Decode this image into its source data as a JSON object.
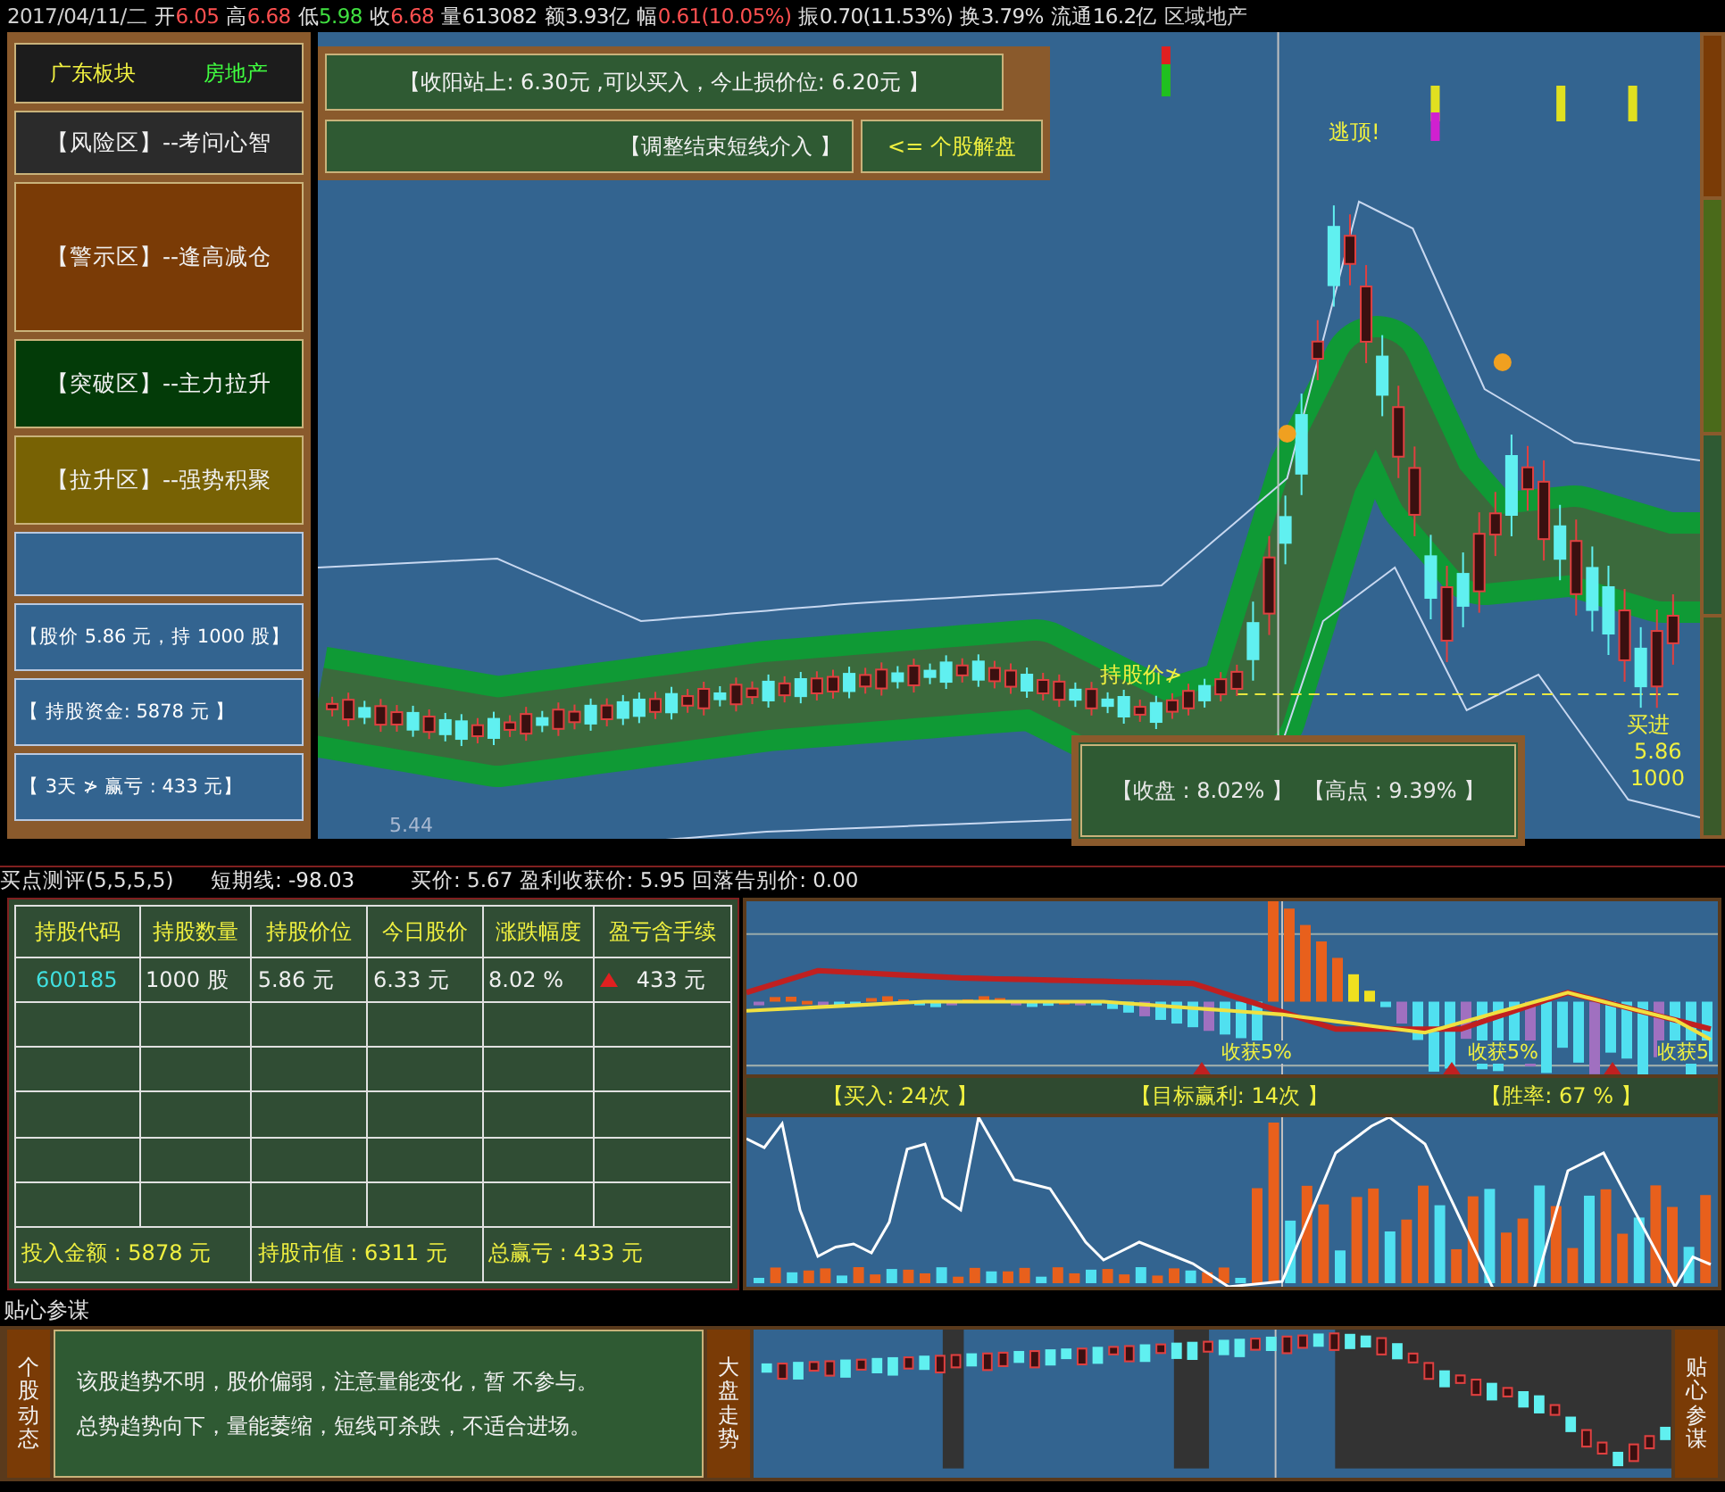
{
  "quote_bar": {
    "date": "2017/04/11/二",
    "fields": [
      {
        "label": "开",
        "value": "6.05",
        "color": "#ff5050"
      },
      {
        "label": "高",
        "value": "6.68",
        "color": "#ff5050"
      },
      {
        "label": "低",
        "value": "5.98",
        "color": "#40e040"
      },
      {
        "label": "收",
        "value": "6.68",
        "color": "#ff5050"
      },
      {
        "label": "量",
        "value": "613082",
        "color": "#e0e0e0"
      },
      {
        "label": "额",
        "value": "3.93亿",
        "color": "#e0e0e0"
      },
      {
        "label": "幅",
        "value": "0.61(10.05%)",
        "color": "#ff5050"
      },
      {
        "label": "振",
        "value": "0.70(11.53%)",
        "color": "#e0e0e0"
      },
      {
        "label": "换",
        "value": "3.79%",
        "color": "#e0e0e0"
      },
      {
        "label": "流通",
        "value": "16.2亿",
        "color": "#e0e0e0"
      }
    ],
    "sector": "区域地产"
  },
  "left_panel": {
    "sector": "广东板块",
    "industry": "房地产",
    "zones": [
      {
        "label": "【风险区】--考问心智",
        "color": "#2b2b2b"
      },
      {
        "label": "【警示区】--逢高减仓",
        "color": "#7a3b06"
      },
      {
        "label": "【突破区】--主力拉升",
        "color": "#033b08"
      },
      {
        "label": "【拉升区】--强势积聚",
        "color": "#786204"
      }
    ],
    "position_lines": [
      "【股价 5.86 元，持 1000 股】",
      "【 持股资金:  5878 元 】",
      "【 3天 ≯ 赢亏 : 433 元】"
    ]
  },
  "chart_overlay": {
    "signal": "【收阳站上: 6.30元 ,可以买入，今止损价位: 6.20元 】",
    "advice": "【调整结束短线介入 】",
    "link": "<= 个股解盘",
    "escape_label": "逃顶!",
    "hold_label": "持股价≯",
    "buy_label": "买进",
    "buy_price": "5.86",
    "buy_qty": "1000",
    "low_label": "5.44",
    "result_box": [
      "【收盘 : 8.02% 】",
      "【高点 : 9.39% 】"
    ]
  },
  "indicator_line": [
    "买点测评(5,5,5,5)",
    "短期线: -98.03",
    "买价: 5.67 盈利收获价: 5.95 回落告别价: 0.00"
  ],
  "holdings_table": {
    "columns": [
      "持股代码",
      "持股数量",
      "持股价位",
      "今日股价",
      "涨跌幅度",
      "盈亏含手续"
    ],
    "rows": [
      {
        "cells": [
          "600185",
          "1000 股",
          "5.86 元",
          "6.33 元",
          "8.02 %",
          "433 元"
        ],
        "up": true
      }
    ],
    "footer": [
      "投入金额 : 5878 元",
      "持股市值 : 6311 元",
      "总赢亏 :   433 元"
    ]
  },
  "signal_panel": {
    "take_profit_labels": [
      "收获5%",
      "收获5%",
      "收获5"
    ],
    "stats": [
      "【买入: 24次 】",
      "【目标赢利: 14次 】",
      "【胜率: 67 % 】"
    ]
  },
  "tips_label": "贴心参谋",
  "bottom": {
    "stock_label": "个股动态",
    "advice": [
      "该股趋势不明，股价偏弱，注意量能变化，暂 不参与。",
      "总势趋势向下，量能萎缩，短线可杀跌，不适合进场。"
    ],
    "market_label": "大盘走势",
    "tips_label": "贴心参谋"
  }
}
